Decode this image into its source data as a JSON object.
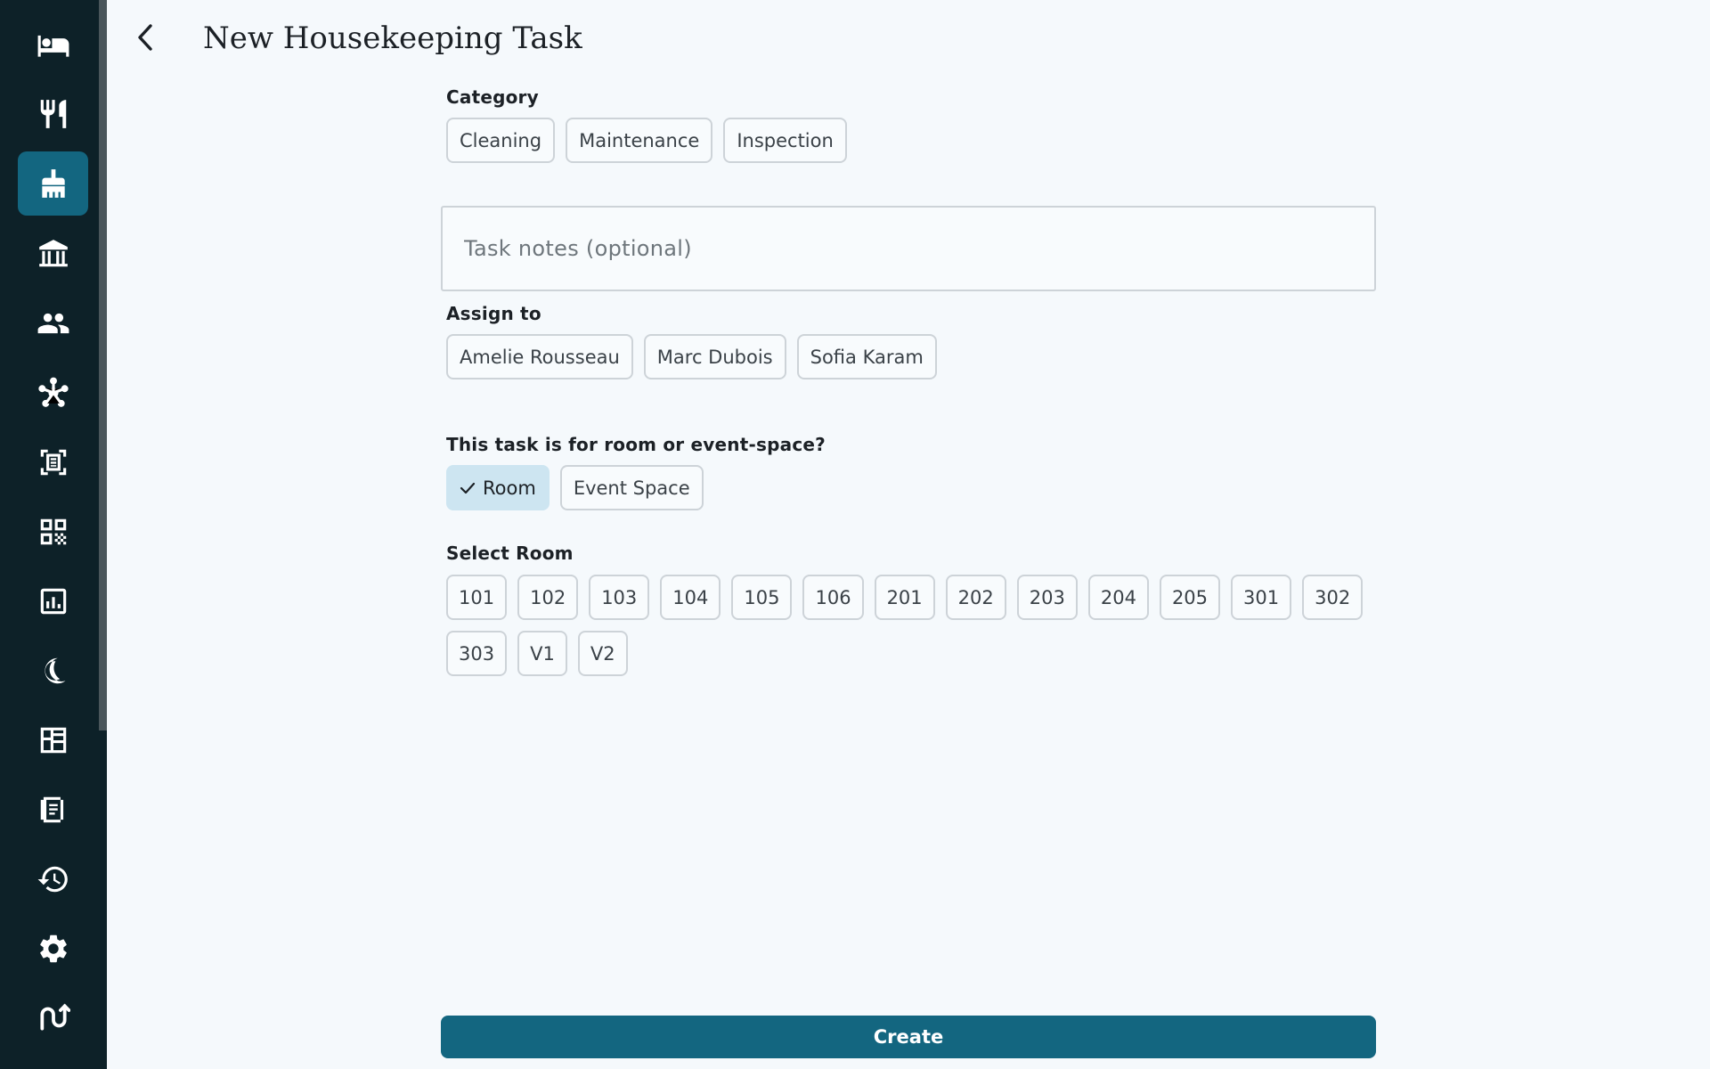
{
  "sidebar": {
    "items": [
      {
        "icon": "bed-icon"
      },
      {
        "icon": "restaurant-icon"
      },
      {
        "icon": "housekeeping-icon",
        "active": true
      },
      {
        "icon": "building-icon"
      },
      {
        "icon": "people-icon"
      },
      {
        "icon": "hub-icon"
      },
      {
        "icon": "document-scanner-icon"
      },
      {
        "icon": "qr-code-icon"
      },
      {
        "icon": "report-icon"
      },
      {
        "icon": "night-audit-icon"
      },
      {
        "icon": "floor-plan-icon"
      },
      {
        "icon": "receipt-icon"
      },
      {
        "icon": "history-icon"
      },
      {
        "icon": "settings-icon"
      },
      {
        "icon": "flow-icon"
      }
    ],
    "accent_color": "#136680",
    "background_color": "#0d2128"
  },
  "header": {
    "title": "New Housekeeping Task",
    "back_icon": "chevron-left-icon"
  },
  "form": {
    "category": {
      "label": "Category",
      "options": [
        "Cleaning",
        "Maintenance",
        "Inspection"
      ]
    },
    "notes": {
      "placeholder": "Task notes (optional)",
      "value": ""
    },
    "assign": {
      "label": "Assign to",
      "options": [
        "Amelie Rousseau",
        "Marc Dubois",
        "Sofia Karam"
      ]
    },
    "space_type": {
      "label": "This task is for room or event-space?",
      "options": [
        "Room",
        "Event Space"
      ],
      "selected": "Room"
    },
    "rooms": {
      "label": "Select Room",
      "row1": [
        "101",
        "102",
        "103",
        "104",
        "105",
        "106",
        "201",
        "202",
        "203",
        "204",
        "205",
        "301",
        "302"
      ],
      "row2": [
        "303",
        "V1",
        "V2"
      ]
    },
    "submit_label": "Create"
  }
}
